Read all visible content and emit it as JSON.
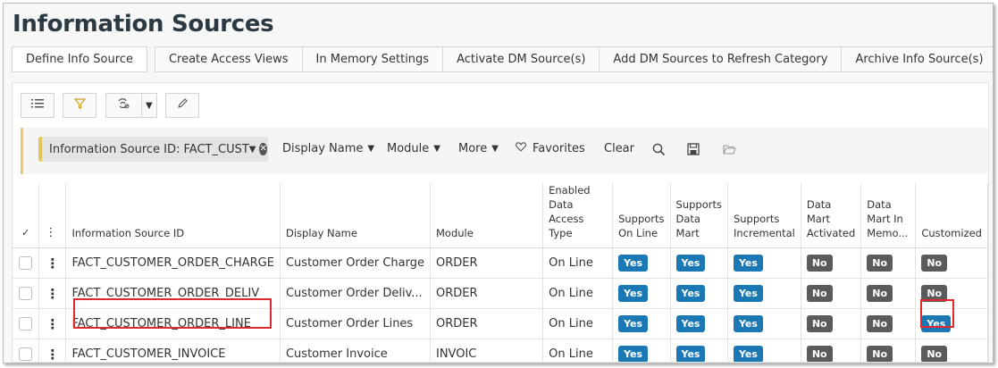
{
  "page": {
    "title": "Information Sources"
  },
  "commands": [
    "Define Info Source",
    "Create Access Views",
    "In Memory Settings",
    "Activate DM Source(s)",
    "Add DM Sources to Refresh Category",
    "Archive Info Source(s)"
  ],
  "filter": {
    "chip_label": "Information Source ID: FACT_CUST",
    "display_name": "Display Name",
    "module": "Module",
    "more": "More",
    "favorites": "Favorites",
    "clear": "Clear"
  },
  "icons": {
    "list": "list-icon",
    "filter": "filter-icon",
    "settings": "settings-icon",
    "edit": "pencil-icon",
    "heart": "heart-icon",
    "search": "search-icon",
    "save": "save-icon",
    "folder": "folder-icon"
  },
  "colors": {
    "yes": "#1a78b4",
    "no": "#5b5b5b",
    "highlight": "#e0282e",
    "filter_accent": "#e6c35c"
  },
  "table": {
    "select_all": "✓",
    "columns": [
      "Information Source ID",
      "Display Name",
      "Module",
      "Enabled Data Access Type",
      "Supports On Line",
      "Supports Data Mart",
      "Supports Incremental",
      "Data Mart Activated",
      "Data Mart In Memo...",
      "Customized"
    ],
    "rows": [
      {
        "id": "FACT_CUSTOMER_ORDER_CHARGE",
        "display": "Customer Order Charge",
        "module": "ORDER",
        "access": "On Line",
        "online": "Yes",
        "datamart": "Yes",
        "incremental": "Yes",
        "activated": "No",
        "inmemory": "No",
        "customized": "No"
      },
      {
        "id": "FACT_CUSTOMER_ORDER_DELIV",
        "display": "Customer Order Deliv...",
        "module": "ORDER",
        "access": "On Line",
        "online": "Yes",
        "datamart": "Yes",
        "incremental": "Yes",
        "activated": "No",
        "inmemory": "No",
        "customized": "No"
      },
      {
        "id": "FACT_CUSTOMER_ORDER_LINE",
        "display": "Customer Order Lines",
        "module": "ORDER",
        "access": "On Line",
        "online": "Yes",
        "datamart": "Yes",
        "incremental": "Yes",
        "activated": "No",
        "inmemory": "No",
        "customized": "Yes"
      },
      {
        "id": "FACT_CUSTOMER_INVOICE",
        "display": "Customer Invoice",
        "module": "INVOIC",
        "access": "On Line",
        "online": "Yes",
        "datamart": "Yes",
        "incremental": "Yes",
        "activated": "No",
        "inmemory": "No",
        "customized": "No"
      }
    ]
  }
}
